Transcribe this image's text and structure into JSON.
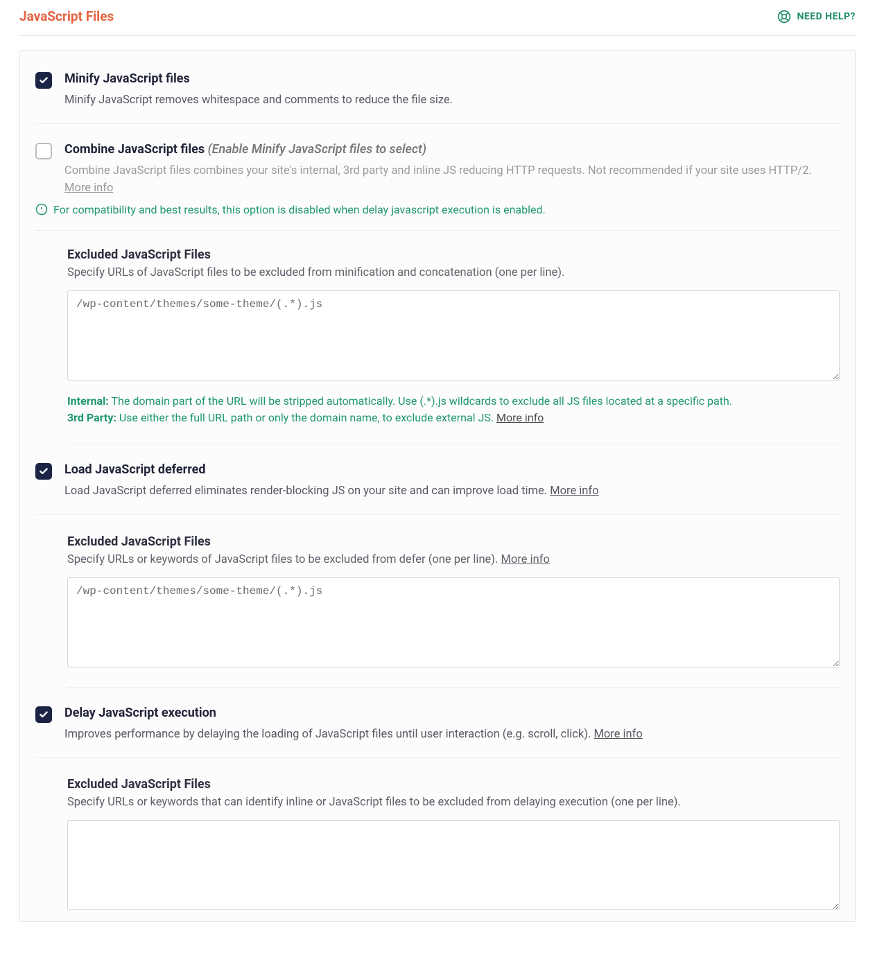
{
  "header": {
    "title": "JavaScript Files",
    "help_label": "NEED HELP?"
  },
  "options": {
    "minify": {
      "checked": true,
      "title": "Minify JavaScript files",
      "desc": "Minify JavaScript removes whitespace and comments to reduce the file size."
    },
    "combine": {
      "checked": false,
      "disabled": true,
      "title_main": "Combine JavaScript files",
      "title_note": "(Enable Minify JavaScript files to select)",
      "desc": "Combine JavaScript files combines your site's internal, 3rd party and inline JS reducing HTTP requests. Not recommended if your site uses HTTP/2.",
      "more_info": "More info",
      "notice": "For compatibility and best results, this option is disabled when delay javascript execution is enabled."
    },
    "excluded_minify": {
      "title": "Excluded JavaScript Files",
      "desc": "Specify URLs of JavaScript files to be excluded from minification and concatenation (one per line).",
      "value": "/wp-content/themes/some-theme/(.*).js",
      "hint_internal_label": "Internal:",
      "hint_internal": "The domain part of the URL will be stripped automatically. Use (.*).js wildcards to exclude all JS files located at a specific path.",
      "hint_thirdparty_label": "3rd Party:",
      "hint_thirdparty": "Use either the full URL path or only the domain name, to exclude external JS.",
      "more_info": "More info"
    },
    "defer": {
      "checked": true,
      "title": "Load JavaScript deferred",
      "desc": "Load JavaScript deferred eliminates render-blocking JS on your site and can improve load time.",
      "more_info": "More info"
    },
    "excluded_defer": {
      "title": "Excluded JavaScript Files",
      "desc": "Specify URLs or keywords of JavaScript files to be excluded from defer (one per line).",
      "more_info": "More info",
      "value": "/wp-content/themes/some-theme/(.*).js"
    },
    "delay": {
      "checked": true,
      "title": "Delay JavaScript execution",
      "desc": "Improves performance by delaying the loading of JavaScript files until user interaction (e.g. scroll, click).",
      "more_info": "More info"
    },
    "excluded_delay": {
      "title": "Excluded JavaScript Files",
      "desc": "Specify URLs or keywords that can identify inline or JavaScript files to be excluded from delaying execution (one per line).",
      "value": ""
    }
  }
}
